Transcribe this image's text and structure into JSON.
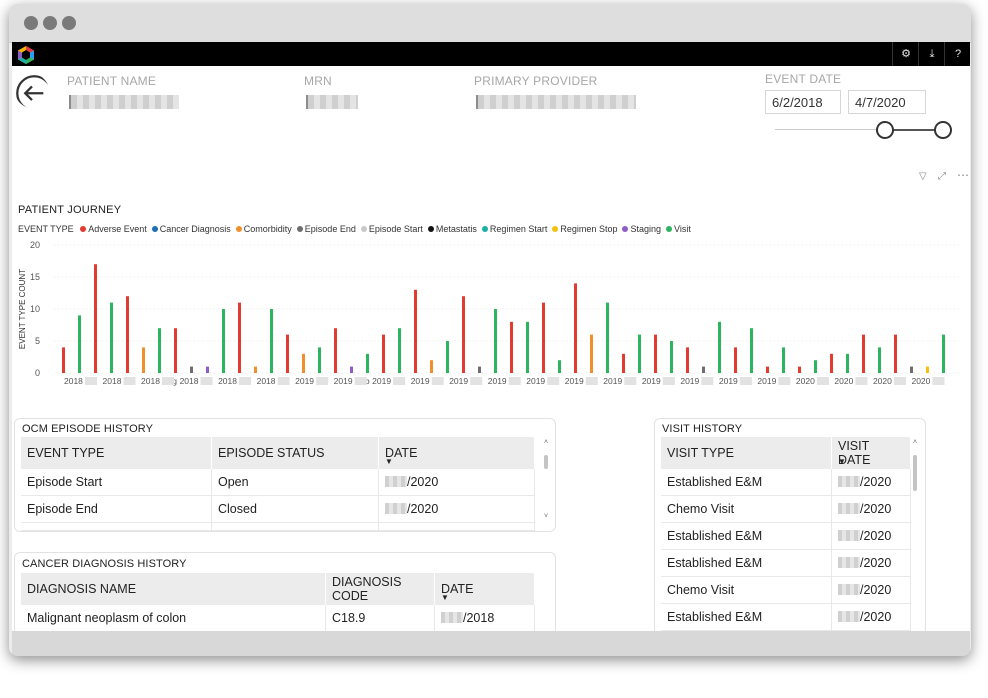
{
  "header": {
    "patient_name_label": "PATIENT NAME",
    "mrn_label": "MRN",
    "primary_provider_label": "PRIMARY PROVIDER",
    "event_date_label": "EVENT DATE",
    "start_date": "6/2/2018",
    "end_date": "4/7/2020"
  },
  "chart_data": {
    "type": "bar",
    "title": "PATIENT JOURNEY",
    "ylabel": "EVENT TYPE COUNT",
    "ylim": [
      0,
      20
    ],
    "yticks": [
      0,
      5,
      10,
      15,
      20
    ],
    "legend_title": "EVENT TYPE",
    "legend": [
      {
        "name": "Adverse Event",
        "color": "#e03c31"
      },
      {
        "name": "Cancer Diagnosis",
        "color": "#1f6fb2"
      },
      {
        "name": "Comorbidity",
        "color": "#f28e2b"
      },
      {
        "name": "Episode End",
        "color": "#6e6e6e"
      },
      {
        "name": "Episode Start",
        "color": "#c9c9c9"
      },
      {
        "name": "Metastatis",
        "color": "#111111"
      },
      {
        "name": "Regimen Start",
        "color": "#1ab0a8"
      },
      {
        "name": "Regimen Stop",
        "color": "#f4c20d"
      },
      {
        "name": "Staging",
        "color": "#8e5cc8"
      },
      {
        "name": "Visit",
        "color": "#2bb55e"
      }
    ],
    "x_tick_labels": [
      "2018",
      "2018",
      "2018 Aug",
      "2018",
      "2018",
      "2018",
      "2019",
      "2019 Feb",
      "2019",
      "2019",
      "2019",
      "2019",
      "2019",
      "2019",
      "2019",
      "2019",
      "2019",
      "2019",
      "2019",
      "2020",
      "2020",
      "2020",
      "2020"
    ],
    "bars": [
      {
        "series": "Adverse Event",
        "value": 4
      },
      {
        "series": "Visit",
        "value": 9
      },
      {
        "series": "Adverse Event",
        "value": 17
      },
      {
        "series": "Visit",
        "value": 11
      },
      {
        "series": "Adverse Event",
        "value": 12
      },
      {
        "series": "Comorbidity",
        "value": 4
      },
      {
        "series": "Visit",
        "value": 7
      },
      {
        "series": "Adverse Event",
        "value": 7
      },
      {
        "series": "Episode End",
        "value": 1
      },
      {
        "series": "Staging",
        "value": 1
      },
      {
        "series": "Visit",
        "value": 10
      },
      {
        "series": "Adverse Event",
        "value": 11
      },
      {
        "series": "Comorbidity",
        "value": 1
      },
      {
        "series": "Visit",
        "value": 10
      },
      {
        "series": "Adverse Event",
        "value": 6
      },
      {
        "series": "Comorbidity",
        "value": 3
      },
      {
        "series": "Visit",
        "value": 4
      },
      {
        "series": "Adverse Event",
        "value": 7
      },
      {
        "series": "Staging",
        "value": 1
      },
      {
        "series": "Visit",
        "value": 3
      },
      {
        "series": "Adverse Event",
        "value": 6
      },
      {
        "series": "Visit",
        "value": 7
      },
      {
        "series": "Adverse Event",
        "value": 13
      },
      {
        "series": "Comorbidity",
        "value": 2
      },
      {
        "series": "Visit",
        "value": 5
      },
      {
        "series": "Adverse Event",
        "value": 12
      },
      {
        "series": "Episode End",
        "value": 1
      },
      {
        "series": "Visit",
        "value": 10
      },
      {
        "series": "Adverse Event",
        "value": 8
      },
      {
        "series": "Visit",
        "value": 8
      },
      {
        "series": "Adverse Event",
        "value": 11
      },
      {
        "series": "Visit",
        "value": 2
      },
      {
        "series": "Adverse Event",
        "value": 14
      },
      {
        "series": "Comorbidity",
        "value": 6
      },
      {
        "series": "Visit",
        "value": 11
      },
      {
        "series": "Adverse Event",
        "value": 3
      },
      {
        "series": "Visit",
        "value": 6
      },
      {
        "series": "Adverse Event",
        "value": 6
      },
      {
        "series": "Visit",
        "value": 5
      },
      {
        "series": "Adverse Event",
        "value": 4
      },
      {
        "series": "Episode End",
        "value": 1
      },
      {
        "series": "Visit",
        "value": 8
      },
      {
        "series": "Adverse Event",
        "value": 4
      },
      {
        "series": "Visit",
        "value": 7
      },
      {
        "series": "Adverse Event",
        "value": 1
      },
      {
        "series": "Visit",
        "value": 4
      },
      {
        "series": "Adverse Event",
        "value": 1
      },
      {
        "series": "Visit",
        "value": 2
      },
      {
        "series": "Adverse Event",
        "value": 3
      },
      {
        "series": "Visit",
        "value": 3
      },
      {
        "series": "Adverse Event",
        "value": 6
      },
      {
        "series": "Visit",
        "value": 4
      },
      {
        "series": "Adverse Event",
        "value": 6
      },
      {
        "series": "Episode End",
        "value": 1
      },
      {
        "series": "Regimen Stop",
        "value": 1
      },
      {
        "series": "Visit",
        "value": 6
      }
    ]
  },
  "ocm": {
    "title": "OCM EPISODE HISTORY",
    "headers": [
      "EVENT TYPE",
      "EPISODE STATUS",
      "DATE"
    ],
    "rows": [
      [
        "Episode Start",
        "Open",
        "/2020"
      ],
      [
        "Episode End",
        "Closed",
        "/2020"
      ]
    ]
  },
  "cancer": {
    "title": "CANCER DIAGNOSIS HISTORY",
    "headers": [
      "DIAGNOSIS NAME",
      "DIAGNOSIS CODE",
      "DATE"
    ],
    "rows": [
      [
        "Malignant neoplasm of colon",
        "C18.9",
        "/2018"
      ]
    ]
  },
  "visits": {
    "title": "VISIT HISTORY",
    "headers": [
      "VISIT TYPE",
      "VISIT DATE"
    ],
    "rows": [
      [
        "Established E&M",
        "/2020"
      ],
      [
        "Chemo Visit",
        "/2020"
      ],
      [
        "Established E&M",
        "/2020"
      ],
      [
        "Established E&M",
        "/2020"
      ],
      [
        "Chemo Visit",
        "/2020"
      ],
      [
        "Established E&M",
        "/2020"
      ]
    ]
  }
}
